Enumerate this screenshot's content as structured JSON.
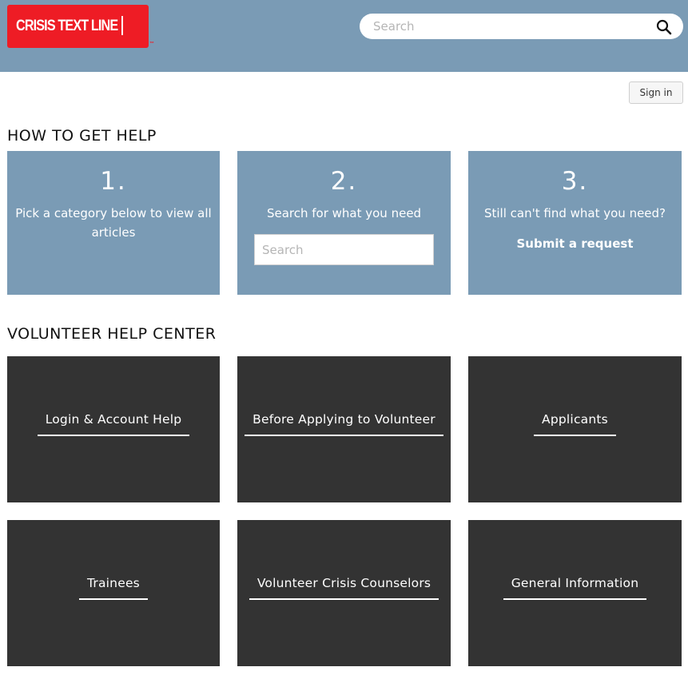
{
  "header": {
    "logo_text": "CRISIS TEXT LINE",
    "logo_tm": "™",
    "search_placeholder": "Search",
    "search_icon": "search-icon",
    "brand_color": "#ee1c25",
    "header_color": "#7a9bb5"
  },
  "account": {
    "signin_label": "Sign in"
  },
  "how_to_get_help": {
    "title": "HOW TO GET HELP",
    "steps": [
      {
        "number": "1.",
        "text": "Pick a category below to view all articles"
      },
      {
        "number": "2.",
        "text": "Search for what you need",
        "search_placeholder": "Search"
      },
      {
        "number": "3.",
        "text": "Still can't find what you need?",
        "link_label": "Submit a request"
      }
    ]
  },
  "help_center": {
    "title": "VOLUNTEER HELP CENTER",
    "tile_color": "#333333",
    "categories": [
      {
        "label": "Login & Account Help"
      },
      {
        "label": "Before Applying to Volunteer"
      },
      {
        "label": "Applicants"
      },
      {
        "label": "Trainees"
      },
      {
        "label": "Volunteer Crisis Counselors"
      },
      {
        "label": "General Information"
      }
    ]
  }
}
